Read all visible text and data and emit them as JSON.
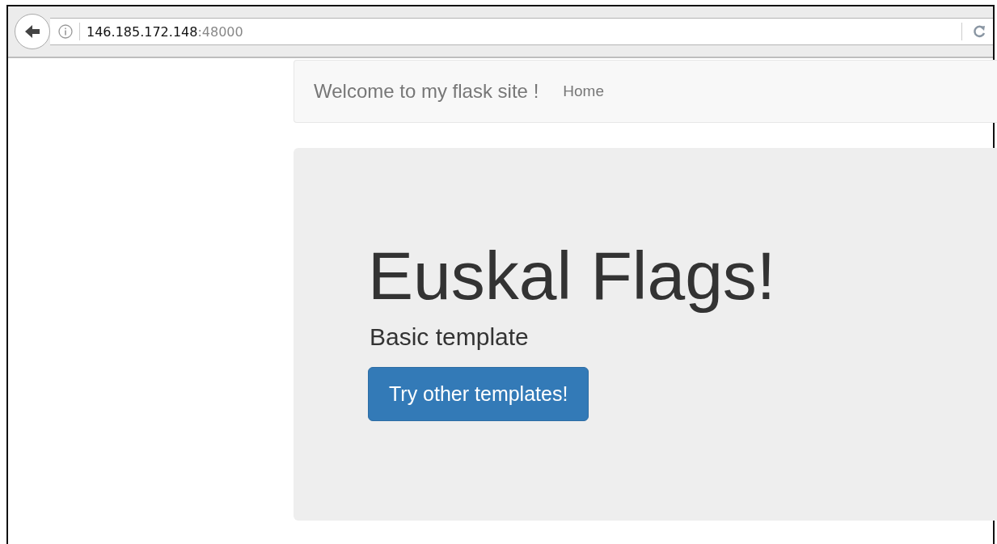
{
  "browser": {
    "address_host": "146.185.172.148",
    "address_port": ":48000"
  },
  "navbar": {
    "brand": "Welcome to my flask site !",
    "links": [
      {
        "label": "Home"
      }
    ]
  },
  "jumbotron": {
    "title": "Euskal Flags!",
    "subtitle": "Basic template",
    "button": "Try other templates!"
  }
}
